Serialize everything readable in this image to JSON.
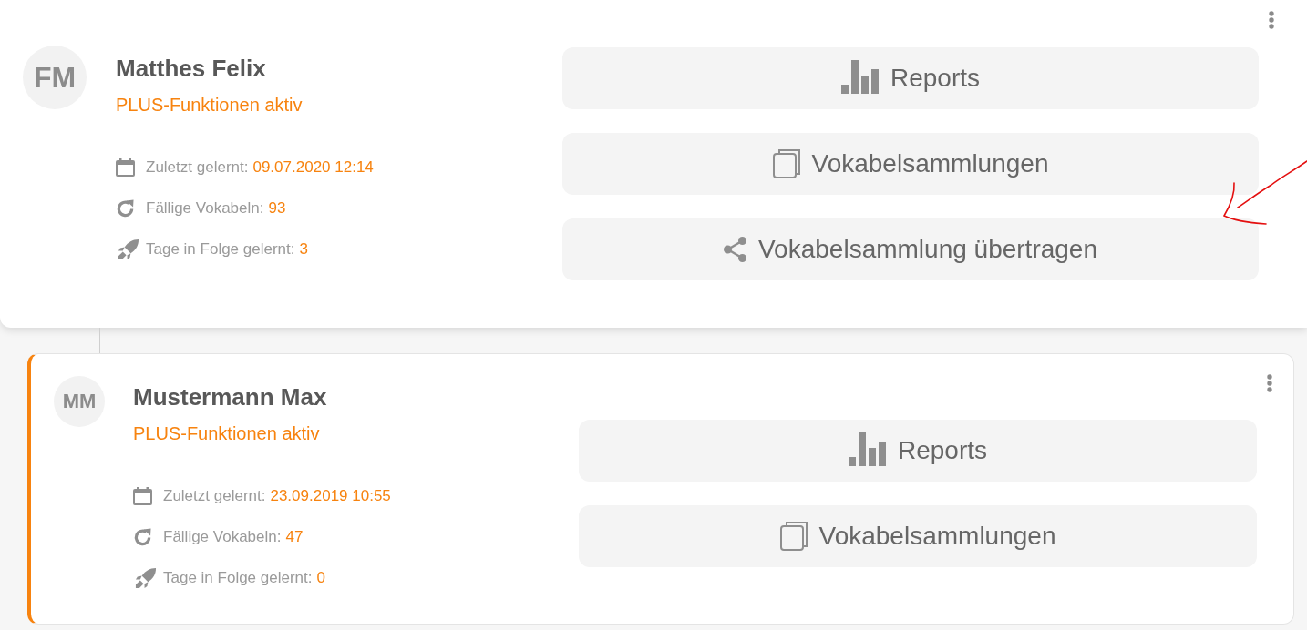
{
  "students": [
    {
      "initials": "FM",
      "name": "Matthes Felix",
      "status": "PLUS-Funktionen aktiv",
      "selected": false,
      "stats": [
        {
          "kind": "last_learned",
          "label": "Zuletzt gelernt:",
          "value": "09.07.2020 12:14"
        },
        {
          "kind": "due",
          "label": "Fällige Vokabeln:",
          "value": "93"
        },
        {
          "kind": "streak",
          "label": "Tage in Folge gelernt:",
          "value": "3"
        }
      ],
      "actions": [
        {
          "kind": "reports",
          "label": "Reports"
        },
        {
          "kind": "collections",
          "label": "Vokabelsammlungen"
        },
        {
          "kind": "share",
          "label": "Vokabelsammlung übertragen"
        }
      ],
      "children": [
        {
          "initials": "MM",
          "name": "Mustermann Max",
          "status": "PLUS-Funktionen aktiv",
          "selected": true,
          "stats": [
            {
              "kind": "last_learned",
              "label": "Zuletzt gelernt:",
              "value": "23.09.2019 10:55"
            },
            {
              "kind": "due",
              "label": "Fällige Vokabeln:",
              "value": "47"
            },
            {
              "kind": "streak",
              "label": "Tage in Folge gelernt:",
              "value": "0"
            }
          ],
          "actions": [
            {
              "kind": "reports",
              "label": "Reports"
            },
            {
              "kind": "collections",
              "label": "Vokabelsammlungen"
            }
          ]
        }
      ]
    }
  ]
}
